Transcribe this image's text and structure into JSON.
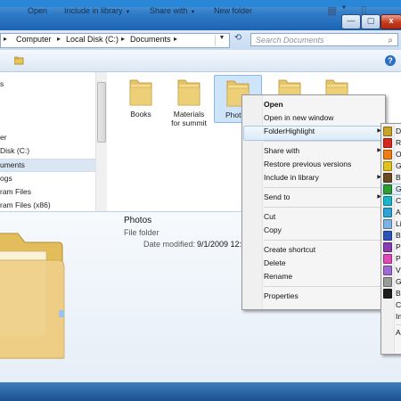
{
  "window": {
    "caption_buttons": {
      "minimize": "—",
      "maximize": "▢",
      "close": "x"
    }
  },
  "address": {
    "back_arrow": "▸",
    "crumbs": [
      "Computer",
      "Local Disk (C:)",
      "Documents"
    ],
    "dropdown": "▼",
    "refresh": "⟲",
    "search_placeholder": "Search Documents",
    "search_icon": "⌕"
  },
  "toolbar": {
    "open": "Open",
    "include_in_library": "Include in library",
    "share_with": "Share with",
    "new_folder": "New folder",
    "caret": "▼",
    "view_icon": "▦",
    "preview_icon": "▯",
    "help_icon": "?"
  },
  "nav": {
    "items": [
      "s",
      "",
      "er",
      "Disk (C:)",
      "uments",
      "ogs",
      "ram Files",
      "ram Files (x86)"
    ],
    "selected_index": 4
  },
  "content": {
    "folders": [
      {
        "label": "Books"
      },
      {
        "label": "Materials for summit"
      },
      {
        "label": "Phot"
      },
      {
        "label": ""
      },
      {
        "label": ""
      }
    ]
  },
  "details": {
    "name": "Photos",
    "type": "File folder",
    "modified_label": "Date modified:",
    "modified_value": "9/1/2009 12:"
  },
  "context_menu": {
    "items": [
      {
        "label": "Open",
        "bold": true
      },
      {
        "label": "Open in new window"
      },
      {
        "label": "FolderHighlight",
        "submenu": true,
        "highlighted": true
      },
      {
        "sep": true
      },
      {
        "label": "Share with",
        "submenu": true
      },
      {
        "label": "Restore previous versions"
      },
      {
        "label": "Include in library",
        "submenu": true
      },
      {
        "sep": true
      },
      {
        "label": "Send to",
        "submenu": true
      },
      {
        "sep": true
      },
      {
        "label": "Cut"
      },
      {
        "label": "Copy"
      },
      {
        "sep": true
      },
      {
        "label": "Create shortcut"
      },
      {
        "label": "Delete"
      },
      {
        "label": "Rename"
      },
      {
        "sep": true
      },
      {
        "label": "Properties"
      }
    ]
  },
  "folderhighlight_submenu": {
    "items": [
      {
        "label": "D",
        "color": "#c9a227"
      },
      {
        "label": "R",
        "color": "#d7261e"
      },
      {
        "label": "O",
        "color": "#ef7d12"
      },
      {
        "label": "G",
        "color": "#e0c21c"
      },
      {
        "label": "B",
        "color": "#6b4a22"
      },
      {
        "label": "G",
        "color": "#2e9d2e",
        "selected": true
      },
      {
        "label": "C",
        "color": "#19b6c8"
      },
      {
        "label": "A",
        "color": "#2aa3d8"
      },
      {
        "label": "Li",
        "color": "#7fb3e6"
      },
      {
        "label": "B",
        "color": "#2a56b8"
      },
      {
        "label": "P",
        "color": "#8b3db4"
      },
      {
        "label": "P",
        "color": "#e048b8"
      },
      {
        "label": "V",
        "color": "#a06ad6"
      },
      {
        "label": "G",
        "color": "#9a9a9a"
      },
      {
        "label": "B",
        "color": "#1e1e1e"
      },
      {
        "label": "C",
        "color": ""
      },
      {
        "label": "In",
        "color": ""
      },
      {
        "sep": true
      },
      {
        "label": "A",
        "color": ""
      }
    ]
  }
}
